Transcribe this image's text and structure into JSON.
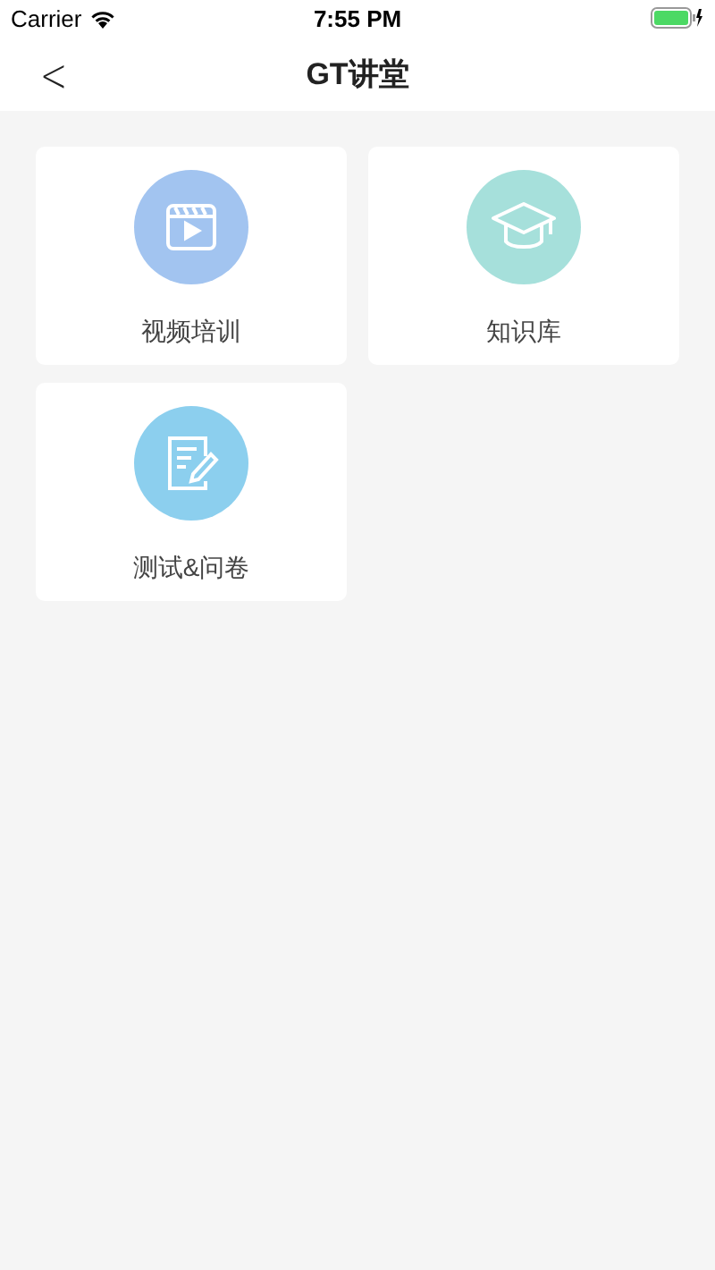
{
  "status_bar": {
    "carrier": "Carrier",
    "time": "7:55 PM"
  },
  "nav": {
    "back": "<",
    "title": "GT讲堂"
  },
  "tiles": [
    {
      "kind": "video",
      "label": "视频培训",
      "color": "#a2c4f0"
    },
    {
      "kind": "cap",
      "label": "知识库",
      "color": "#a6e0db"
    },
    {
      "kind": "note",
      "label": "测试&问卷",
      "color": "#8ccfee"
    }
  ]
}
